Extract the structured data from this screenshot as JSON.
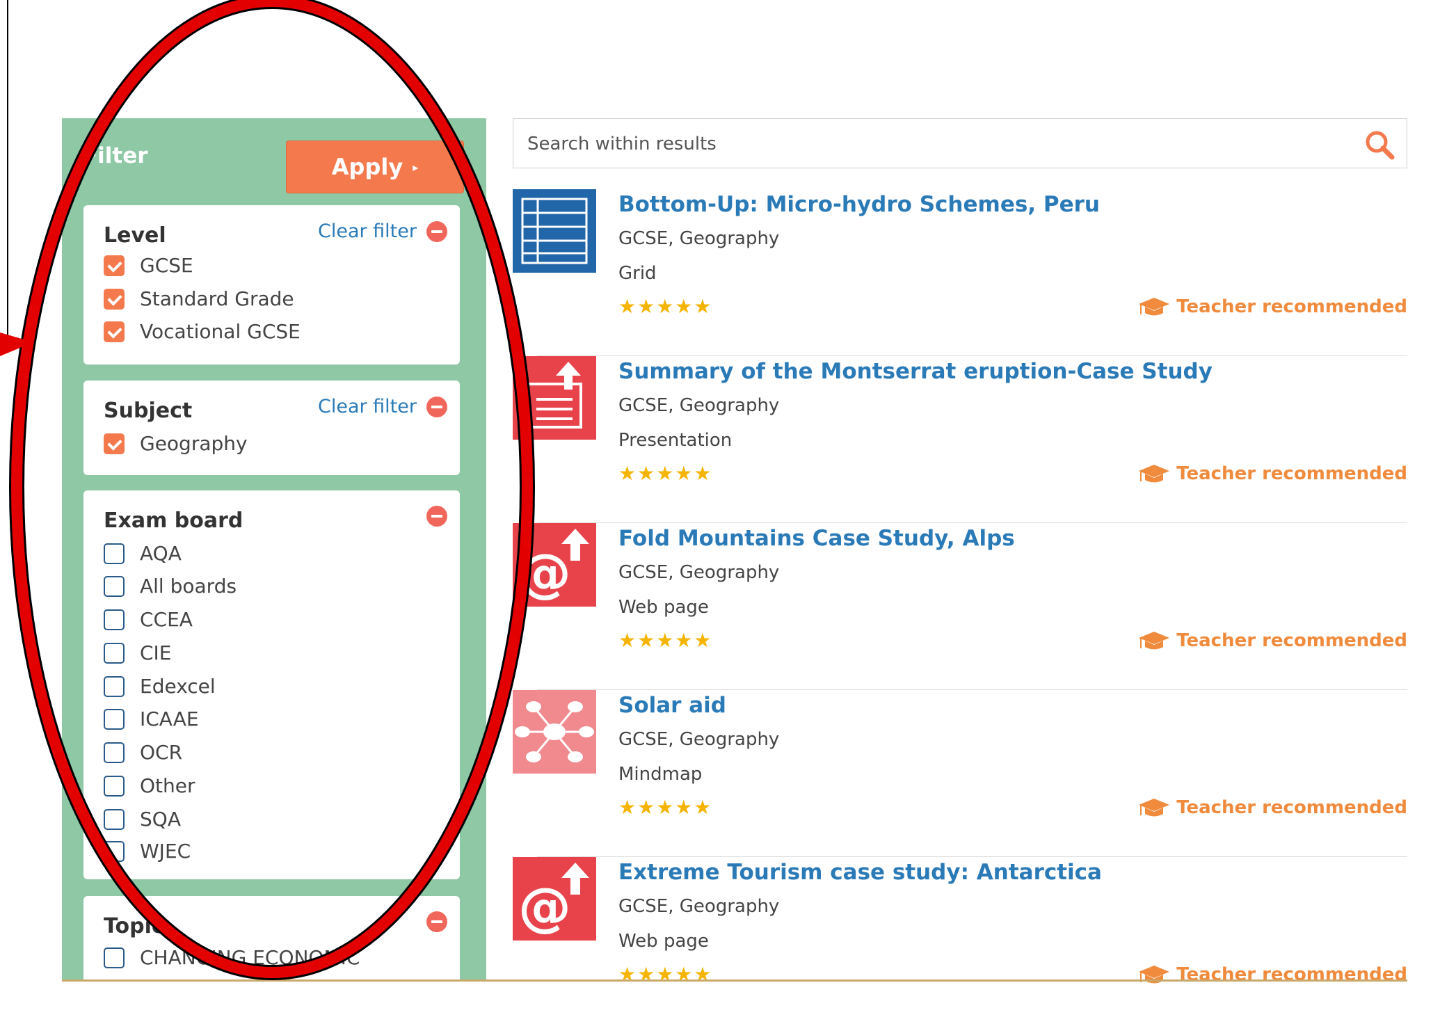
{
  "filter": {
    "title": "Filter",
    "apply_label": "Apply",
    "apply_arrow": "▸",
    "panel_color": "#8ec8a5",
    "accent_color": "#f47a4e",
    "level": {
      "heading": "Level",
      "clear_label": "Clear filter",
      "options": [
        {
          "label": "GCSE",
          "checked": true
        },
        {
          "label": "Standard Grade",
          "checked": true
        },
        {
          "label": "Vocational GCSE",
          "checked": true
        }
      ]
    },
    "subject": {
      "heading": "Subject",
      "clear_label": "Clear filter",
      "options": [
        {
          "label": "Geography",
          "checked": true
        }
      ]
    },
    "exam_board": {
      "heading": "Exam board",
      "options": [
        {
          "label": "AQA",
          "checked": false
        },
        {
          "label": "All boards",
          "checked": false
        },
        {
          "label": "CCEA",
          "checked": false
        },
        {
          "label": "CIE",
          "checked": false
        },
        {
          "label": "Edexcel",
          "checked": false
        },
        {
          "label": "ICAAE",
          "checked": false
        },
        {
          "label": "OCR",
          "checked": false
        },
        {
          "label": "Other",
          "checked": false
        },
        {
          "label": "SQA",
          "checked": false
        },
        {
          "label": "WJEC",
          "checked": false
        }
      ]
    },
    "topic": {
      "heading": "Topic",
      "options": [
        {
          "label": "CHANGING ECONOMIC",
          "checked": false
        }
      ]
    }
  },
  "search": {
    "placeholder": "Search within results",
    "icon": "search-icon"
  },
  "results": [
    {
      "title": "Bottom-Up: Micro-hydro Schemes, Peru",
      "meta": "GCSE, Geography",
      "type": "Grid",
      "stars": "★★★★★",
      "badge": "Teacher recommended",
      "icon": "grid-doc-icon",
      "thumb_color": "#2166a8"
    },
    {
      "title": "Summary of the Montserrat eruption-Case Study",
      "meta": "GCSE, Geography",
      "type": "Presentation",
      "stars": "★★★★★",
      "badge": "Teacher recommended",
      "icon": "presentation-icon",
      "thumb_color": "#e8424b"
    },
    {
      "title": "Fold Mountains Case Study, Alps",
      "meta": "GCSE, Geography",
      "type": "Web page",
      "stars": "★★★★★",
      "badge": "Teacher recommended",
      "icon": "web-page-icon",
      "thumb_color": "#e8424b"
    },
    {
      "title": "Solar aid",
      "meta": "GCSE, Geography",
      "type": "Mindmap",
      "stars": "★★★★★",
      "badge": "Teacher recommended",
      "icon": "mindmap-icon",
      "thumb_color": "#f08a8f"
    },
    {
      "title": "Extreme Tourism case study: Antarctica",
      "meta": "GCSE, Geography",
      "type": "Web page",
      "stars": "★★★★★",
      "badge": "Teacher recommended",
      "icon": "web-page-icon",
      "thumb_color": "#e8424b"
    }
  ],
  "annotation": {
    "ellipse_color": "#e20000",
    "outline_color": "#000000"
  }
}
